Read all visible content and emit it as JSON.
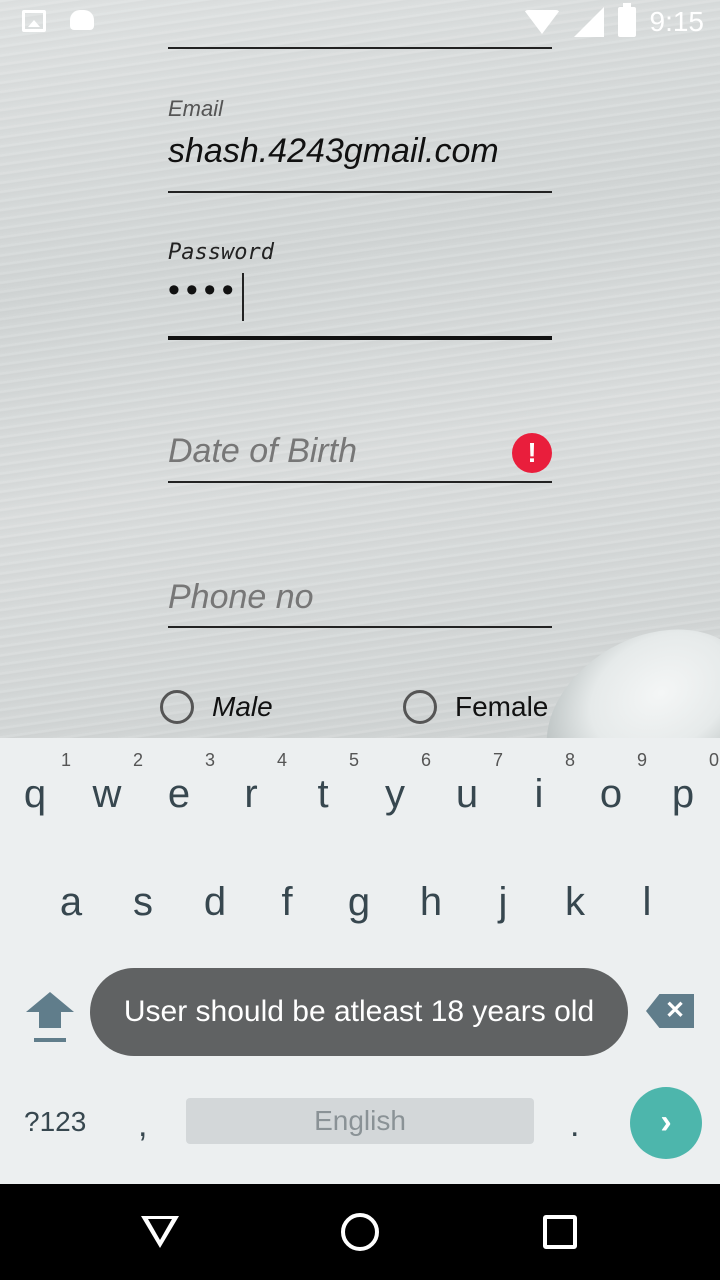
{
  "status_bar": {
    "time": "9:15",
    "icons": [
      "image-icon",
      "android-icon",
      "wifi-icon",
      "signal-icon",
      "battery-charging-icon"
    ]
  },
  "form": {
    "email": {
      "label": "Email",
      "value": "shash.4243gmail.com"
    },
    "password": {
      "label": "Password",
      "masked_value": "••••"
    },
    "dob": {
      "placeholder": "Date of Birth",
      "error_icon": "error-icon"
    },
    "phone": {
      "placeholder": "Phone no"
    },
    "gender": {
      "male": "Male",
      "female": "Female"
    }
  },
  "keyboard": {
    "row1": [
      {
        "key": "q",
        "num": "1"
      },
      {
        "key": "w",
        "num": "2"
      },
      {
        "key": "e",
        "num": "3"
      },
      {
        "key": "r",
        "num": "4"
      },
      {
        "key": "t",
        "num": "5"
      },
      {
        "key": "y",
        "num": "6"
      },
      {
        "key": "u",
        "num": "7"
      },
      {
        "key": "i",
        "num": "8"
      },
      {
        "key": "o",
        "num": "9"
      },
      {
        "key": "p",
        "num": "0"
      }
    ],
    "row2": [
      "a",
      "s",
      "d",
      "f",
      "g",
      "h",
      "j",
      "k",
      "l"
    ],
    "symbols_label": "?123",
    "comma": ",",
    "space_label": "English",
    "period": "."
  },
  "toast": {
    "message": "User should be atleast 18 years old"
  },
  "colors": {
    "error": "#e91e3c",
    "accent": "#4db6ac",
    "toast_bg": "#606263"
  }
}
